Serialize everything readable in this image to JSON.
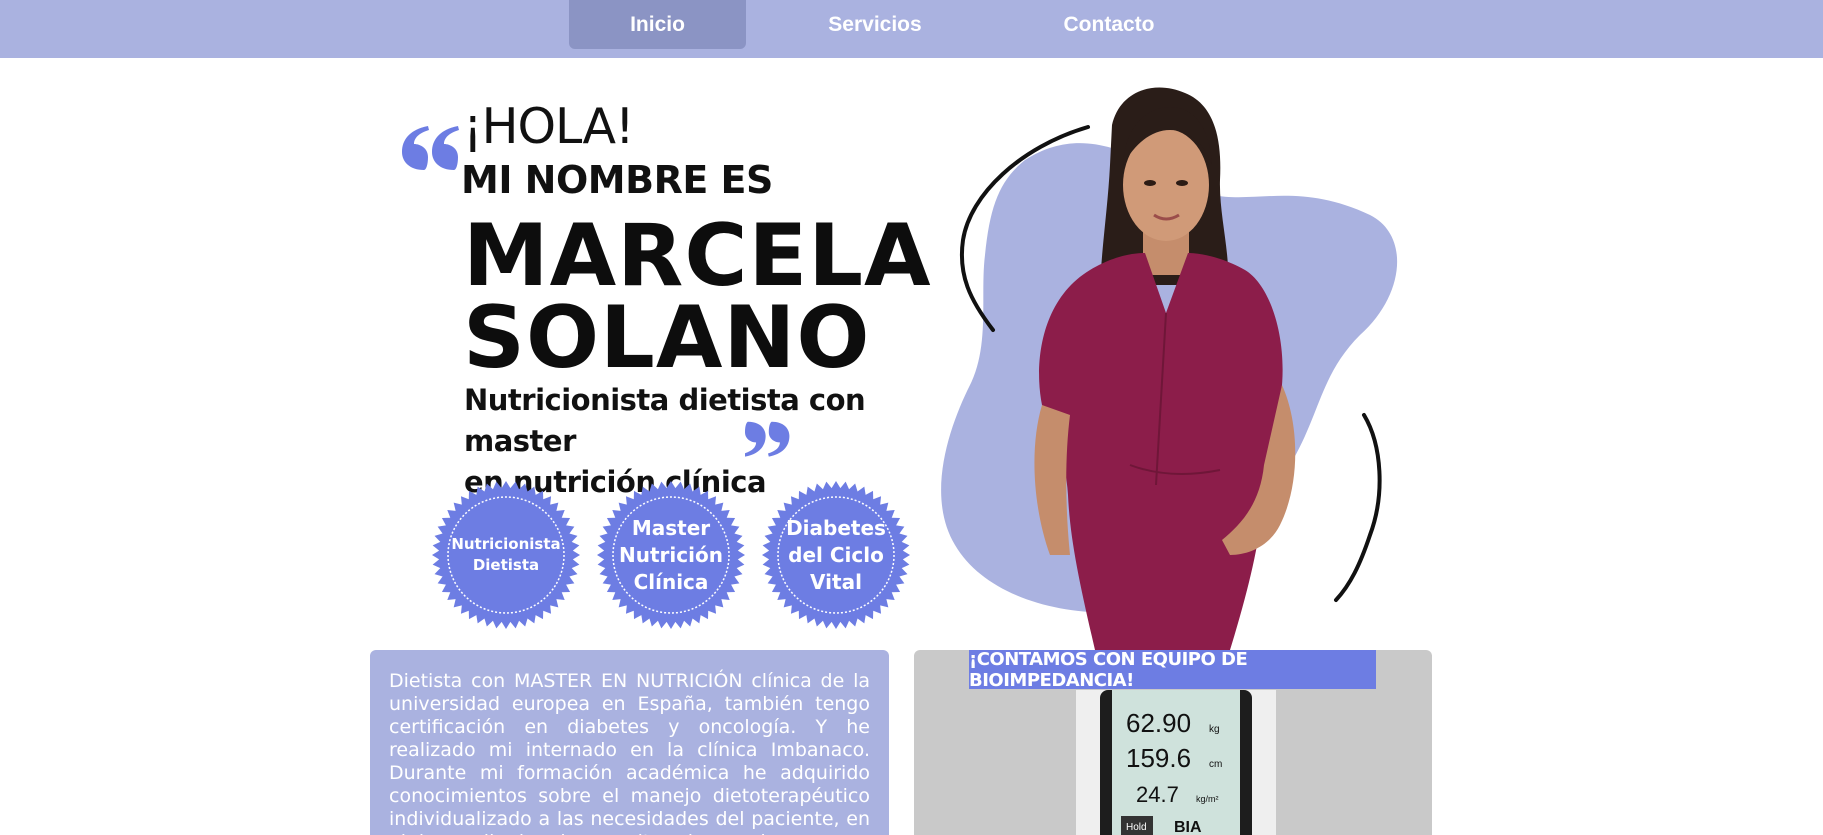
{
  "nav": {
    "items": [
      {
        "label": "Inicio",
        "active": true
      },
      {
        "label": "Servicios",
        "active": false
      },
      {
        "label": "Contacto",
        "active": false
      }
    ]
  },
  "hero": {
    "greeting": "¡HOLA!",
    "intro": "MI NOMBRE ES",
    "first_name": "MARCELA",
    "last_name": "SOLANO",
    "subtitle_line1": "Nutricionista dietista con master",
    "subtitle_line2": "en nutrición clínica"
  },
  "badges": [
    {
      "line1": "Nutricionista",
      "line2": "Dietista",
      "line3": ""
    },
    {
      "line1": "Master",
      "line2": "Nutrición",
      "line3": "Clínica"
    },
    {
      "line1": "Diabetes",
      "line2": "del Ciclo",
      "line3": "Vital"
    }
  ],
  "bio": {
    "text": "Dietista con MASTER EN NUTRICIÓN clínica de la universidad europea en España, también tengo certificación en diabetes y oncología. Y he realizado mi internado en la clínica Imbanaco. Durante mi formación académica he adquirido conocimientos sobre el manejo dietoterapéutico individualizado a las necesidades del paciente, en el desarrollo de mis consultas siempre busco"
  },
  "bioimpedance": {
    "banner": "¡CONTAMOS CON EQUIPO DE BIOIMPEDANCIA!",
    "readings": [
      {
        "value": "62.90",
        "unit": "kg"
      },
      {
        "value": "159.6",
        "unit": "cm"
      },
      {
        "value": "24.7",
        "unit": "kg/m²"
      }
    ],
    "hold_label": "Hold",
    "bia_label": "BIA"
  },
  "colors": {
    "nav_bg": "#aab2e0",
    "nav_active": "#8b94c4",
    "accent": "#6d7de3",
    "blob": "#aab2e0",
    "scrub": "#8c1d4a"
  }
}
